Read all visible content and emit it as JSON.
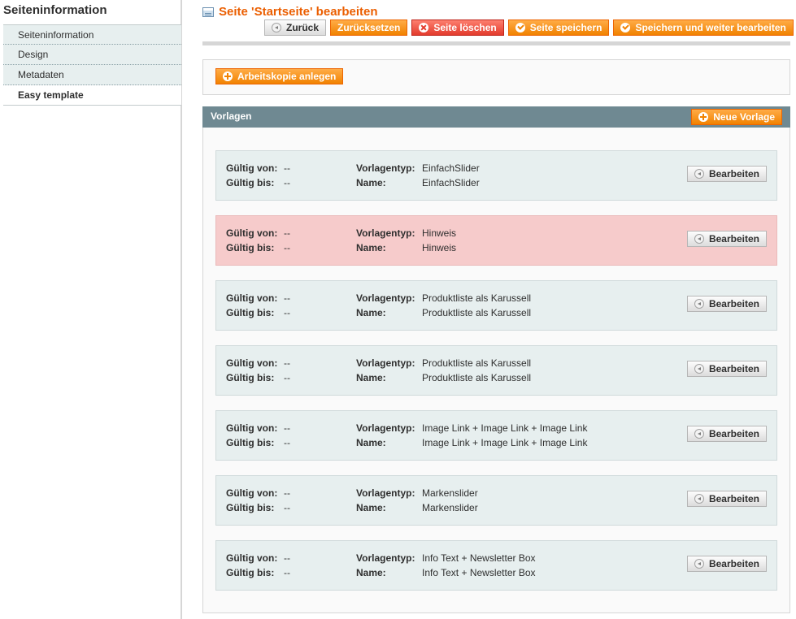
{
  "sidebar": {
    "title": "Seiteninformation",
    "tabs": [
      {
        "label": "Seiteninformation"
      },
      {
        "label": "Design"
      },
      {
        "label": "Metadaten"
      },
      {
        "label": "Easy template"
      }
    ]
  },
  "header": {
    "title": "Seite 'Startseite' bearbeiten",
    "buttons": {
      "back": "Zurück",
      "reset": "Zurücksetzen",
      "delete": "Seite löschen",
      "save": "Seite speichern",
      "save_continue": "Speichern und weiter bearbeiten"
    }
  },
  "workcopy_button": "Arbeitskopie anlegen",
  "templates_section": {
    "title": "Vorlagen",
    "new_button": "Neue Vorlage",
    "labels": {
      "valid_from": "Gültig von:",
      "valid_to": "Gültig bis:",
      "type": "Vorlagentyp:",
      "name": "Name:"
    },
    "edit_label": "Bearbeiten",
    "items": [
      {
        "valid_from": "--",
        "valid_to": "--",
        "type": "EinfachSlider",
        "name": "EinfachSlider"
      },
      {
        "valid_from": "--",
        "valid_to": "--",
        "type": "Hinweis",
        "name": "Hinweis"
      },
      {
        "valid_from": "--",
        "valid_to": "--",
        "type": "Produktliste als Karussell",
        "name": "Produktliste als Karussell"
      },
      {
        "valid_from": "--",
        "valid_to": "--",
        "type": "Produktliste als Karussell",
        "name": "Produktliste als Karussell"
      },
      {
        "valid_from": "--",
        "valid_to": "--",
        "type": "Image Link + Image Link + Image Link",
        "name": "Image Link + Image Link + Image Link"
      },
      {
        "valid_from": "--",
        "valid_to": "--",
        "type": "Markenslider",
        "name": "Markenslider"
      },
      {
        "valid_from": "--",
        "valid_to": "--",
        "type": "Info Text + Newsletter Box",
        "name": "Info Text + Newsletter Box"
      }
    ]
  }
}
